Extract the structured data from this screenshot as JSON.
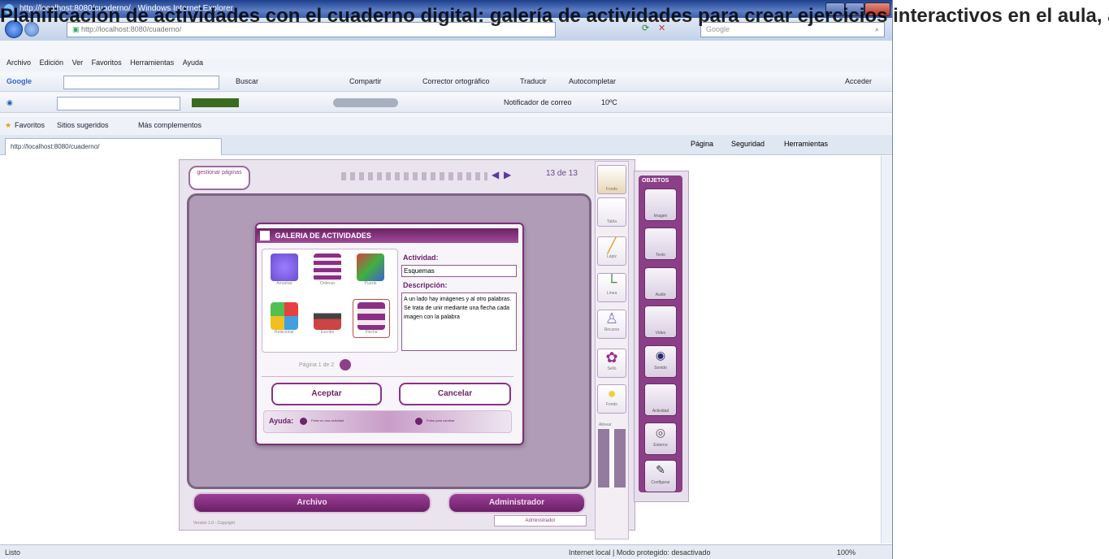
{
  "overlay_text": "Planificación de actividades con el cuaderno digital: galería de actividades para crear ejercicios interactivos en el aula, aplicación web, cuaderno de trabajo, imagen, palabra, relacionar cen",
  "window": {
    "title": "http://localhost:8080/cuaderno/ - Windows Internet Explorer",
    "address": "http://localhost:8080/cuaderno/",
    "search_placeholder": "Google"
  },
  "menu": [
    "Archivo",
    "Edición",
    "Ver",
    "Favoritos",
    "Herramientas",
    "Ayuda"
  ],
  "google_toolbar": {
    "logo": "Google",
    "buscar": "Buscar",
    "compartir": "Compartir",
    "corrector": "Corrector ortográfico",
    "traducir": "Traducir",
    "autocompletar": "Autocompletar",
    "acceder": "Acceder"
  },
  "second_toolbar": {
    "notificador": "Notificador de correo",
    "clima": "10ºC"
  },
  "favorites": {
    "favoritos": "Favoritos",
    "sitios": "Sitios sugeridos",
    "complementos": "Más complementos"
  },
  "tab_title": "http://localhost:8080/cuaderno/",
  "ie_commands": {
    "pagina": "Página",
    "seguridad": "Seguridad",
    "herramientas": "Herramientas"
  },
  "app": {
    "page_btn": "gestionar páginas",
    "page_counter": "13 de 13",
    "objects_title": "OBJETOS",
    "archivo_btn": "Archivo",
    "admin_btn": "Administrador",
    "admin_sub": "Administrador",
    "footer": "Versión 1.0 - Copyright"
  },
  "tools": [
    "Fondo",
    "Tabla",
    "Lápiz",
    "Línea",
    "Recurso",
    "Sello",
    "Fondo"
  ],
  "align_label": "Alinear",
  "objects": [
    "Imagen",
    "Texto",
    "Audio",
    "Video",
    "Sonido",
    "Actividad",
    "Externo",
    "Configurar"
  ],
  "dialog": {
    "title": "GALERIA DE ACTIVIDADES",
    "activity_label": "Actividad:",
    "activity_value": "Esquemas",
    "desc_label": "Descripción:",
    "desc_value": "A un lado hay imágenes y al otro palabras. Se trata de unir mediante una flecha cada imagen con la palabra",
    "thumbs": [
      "Arrastrar",
      "Ordenar",
      "Puzzle",
      "Relacionar",
      "Escribir",
      "Flecha"
    ],
    "pagination": "Página 1 de 2",
    "accept": "Aceptar",
    "cancel": "Cancelar",
    "help_label": "Ayuda:",
    "help1": "Pulse en una actividad",
    "help2": "Pulse para cambiar"
  },
  "status": {
    "left": "Listo",
    "zone": "Internet local | Modo protegido: desactivado",
    "zoom": "100%"
  }
}
